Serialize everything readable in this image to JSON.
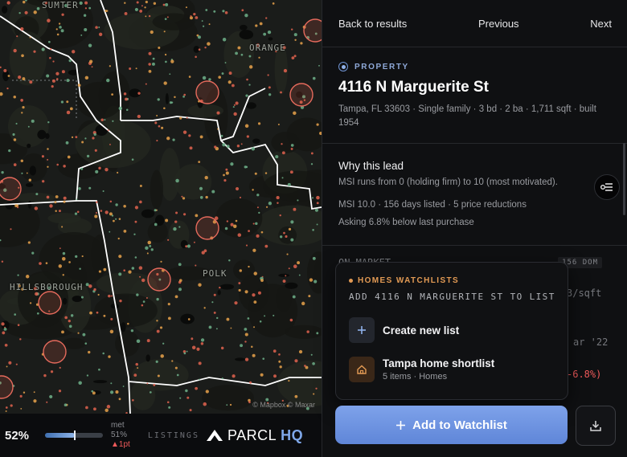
{
  "map": {
    "counties": [
      "SUMTER",
      "ORANGE",
      "HILLSBOROUGH",
      "POLK"
    ],
    "attribution": "© Mapbox © Maxar",
    "colors": {
      "background": "#1a1c1a",
      "boundary": "#ffffff",
      "dot_hot": "#e2634f",
      "dot_warm": "#e9a24b",
      "dot_cool": "#6fb08a"
    }
  },
  "bottom_bar": {
    "percent": "52%",
    "slider_level": 0.52,
    "met_label": "met",
    "met_value": "51%",
    "met_delta": "▲1pt",
    "listings_label": "LISTINGS",
    "logo_name": "PARCL",
    "logo_suffix": "HQ"
  },
  "nav": {
    "back": "Back to results",
    "previous": "Previous",
    "next": "Next"
  },
  "property": {
    "tag": "PROPERTY",
    "address": "4116 N Marguerite St",
    "meta": "Tampa, FL 33603 · Single family · 3 bd · 2 ba · 1,711 sqft · built 1954"
  },
  "why": {
    "title": "Why this lead",
    "description": "MSI runs from 0 (holding firm) to 10 (most motivated).",
    "stats": "MSI 10.0 · 156 days listed · 5 price reductions",
    "asking": "Asking 6.8% below last purchase"
  },
  "behind": {
    "market_label": "ON MARKET",
    "dom_badge": "156 DOM",
    "sqft": "3/sqft",
    "date": "ar '22",
    "change": "-6.8%)"
  },
  "watchlist_popup": {
    "tag": "HOMES WATCHLISTS",
    "title": "ADD 4116 N MARGUERITE ST TO LIST",
    "create_label": "Create new list",
    "list_name": "Tampa home shortlist",
    "list_meta": "5 items · Homes"
  },
  "actions": {
    "add_label": "Add to Watchlist",
    "icons": [
      "plus-icon",
      "download-icon"
    ]
  },
  "colors": {
    "accent": "#6f93d2",
    "orange": "#e29a54",
    "button": "#6f94e0",
    "danger": "#ef5a5a"
  }
}
